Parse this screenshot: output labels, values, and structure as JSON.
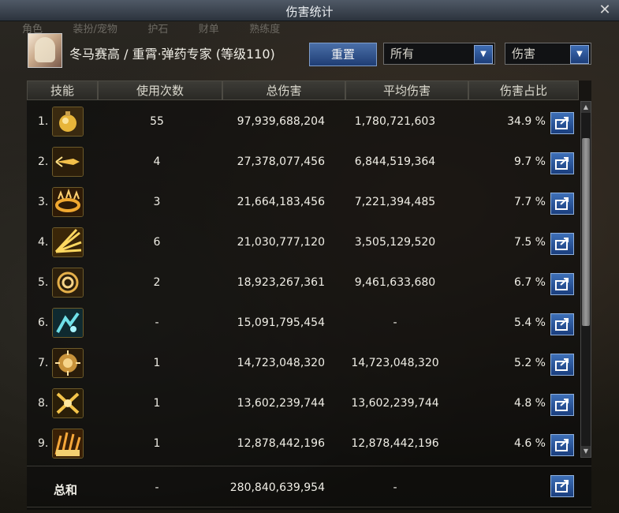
{
  "window": {
    "title": "伤害统计",
    "close_glyph": "✕"
  },
  "bg_tabs": [
    "角色",
    "装扮/宠物",
    "护石",
    "财单",
    "熟练度"
  ],
  "header": {
    "character": "冬马赛高 / 重霄·弹药专家 (等级110)",
    "reset_label": "重置",
    "filter_value": "所有",
    "metric_value": "伤害"
  },
  "columns": {
    "skill": "技能",
    "uses": "使用次数",
    "total": "总伤害",
    "avg": "平均伤害",
    "pct": "伤害占比"
  },
  "rows": [
    {
      "rank": "1.",
      "uses": "55",
      "total": "97,939,688,204",
      "avg": "1,780,721,603",
      "pct": "34.9 %",
      "icon": "grenade-icon"
    },
    {
      "rank": "2.",
      "uses": "4",
      "total": "27,378,077,456",
      "avg": "6,844,519,364",
      "pct": "9.7 %",
      "icon": "rocket-icon"
    },
    {
      "rank": "3.",
      "uses": "3",
      "total": "21,664,183,456",
      "avg": "7,221,394,485",
      "pct": "7.7 %",
      "icon": "fire-ring-icon"
    },
    {
      "rank": "4.",
      "uses": "6",
      "total": "21,030,777,120",
      "avg": "3,505,129,520",
      "pct": "7.5 %",
      "icon": "burst-icon"
    },
    {
      "rank": "5.",
      "uses": "2",
      "total": "18,923,267,361",
      "avg": "9,461,633,680",
      "pct": "6.7 %",
      "icon": "vortex-icon"
    },
    {
      "rank": "6.",
      "uses": "-",
      "total": "15,091,795,454",
      "avg": "-",
      "pct": "5.4 %",
      "icon": "ice-shard-icon"
    },
    {
      "rank": "7.",
      "uses": "1",
      "total": "14,723,048,320",
      "avg": "14,723,048,320",
      "pct": "5.2 %",
      "icon": "explosion-icon"
    },
    {
      "rank": "8.",
      "uses": "1",
      "total": "13,602,239,744",
      "avg": "13,602,239,744",
      "pct": "4.8 %",
      "icon": "crossfire-icon"
    },
    {
      "rank": "9.",
      "uses": "1",
      "total": "12,878,442,196",
      "avg": "12,878,442,196",
      "pct": "4.6 %",
      "icon": "blast-wave-icon"
    }
  ],
  "total": {
    "label": "总和",
    "uses": "-",
    "total": "280,840,639,954",
    "avg": "-"
  },
  "colors": {
    "accent_blue": "#2a5aa0",
    "icon_gold": "#f0c040"
  }
}
